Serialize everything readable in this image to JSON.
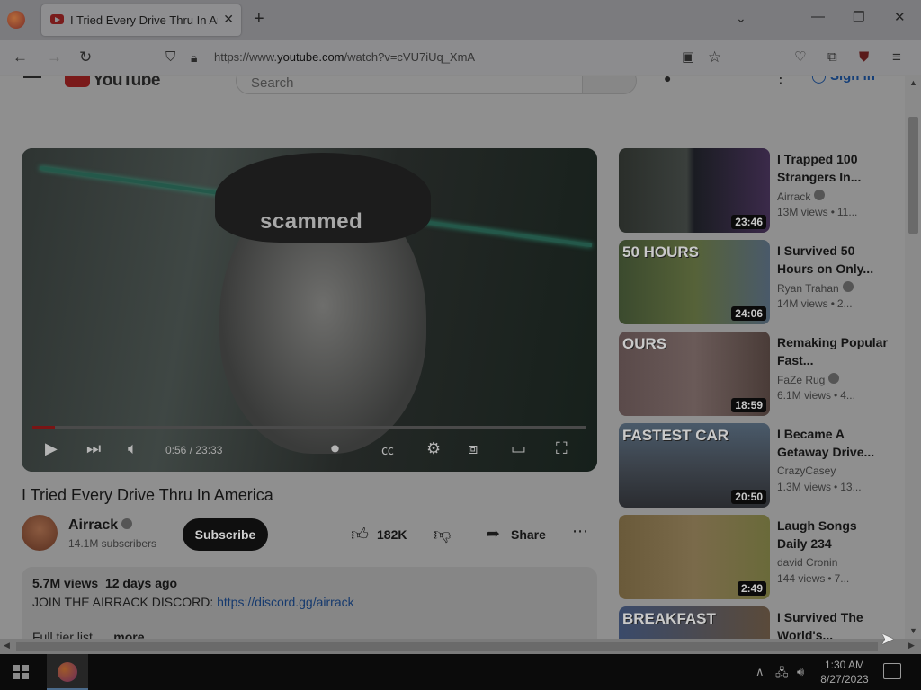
{
  "browser": {
    "tab_title": "I Tried Every Drive Thru In Ame",
    "tab_close": "✕",
    "new_tab": "+",
    "tab_list": "⌄",
    "minimize": "—",
    "maximize": "❐",
    "close": "✕",
    "url_prefix": "https://www.",
    "url_domain": "youtube.com",
    "url_suffix": "/watch?v=cVU7iUq_XmA"
  },
  "youtube": {
    "logo_text": "YouTube",
    "search_placeholder": "Search",
    "sign_in": "Sign in"
  },
  "player": {
    "overlay_text": "scammed",
    "time_current": "0:56",
    "time_sep": " / ",
    "time_total": "23:33",
    "progress_fraction": 0.04
  },
  "video": {
    "title": "I Tried Every Drive Thru In America",
    "channel": "Airrack",
    "subscribers": "14.1M subscribers",
    "subscribe_label": "Subscribe",
    "likes": "182K",
    "share_label": "Share",
    "views": "5.7M views",
    "age": "12 days ago",
    "desc_line1_prefix": "JOIN THE AIRRACK DISCORD: ",
    "desc_link": "https://discord.gg/airrack",
    "desc_line2": "Full tier list",
    "more_label": "...more"
  },
  "recommendations": [
    {
      "title": "I Trapped 100 Strangers In...",
      "channel": "Airrack",
      "views": "13M views",
      "age": "11...",
      "duration": "23:46",
      "thumb_text": "",
      "verified": true
    },
    {
      "title": "I Survived 50 Hours on Only...",
      "channel": "Ryan Trahan",
      "views": "14M views",
      "age": "2...",
      "duration": "24:06",
      "thumb_text": "50 HOURS",
      "verified": true
    },
    {
      "title": "Remaking Popular Fast...",
      "channel": "FaZe Rug",
      "views": "6.1M views",
      "age": "4...",
      "duration": "18:59",
      "thumb_text": "OURS",
      "verified": true
    },
    {
      "title": "I Became A Getaway Drive...",
      "channel": "CrazyCasey",
      "views": "1.3M views",
      "age": "13...",
      "duration": "20:50",
      "thumb_text": "FASTEST CAR",
      "verified": false
    },
    {
      "title": "Laugh Songs Daily 234",
      "channel": "david Cronin",
      "views": "144 views",
      "age": "7...",
      "duration": "2:49",
      "thumb_text": "",
      "verified": false
    },
    {
      "title": "I Survived The World's...",
      "channel": "",
      "views": "",
      "age": "",
      "duration": "",
      "thumb_text": "BREAKFAST",
      "verified": false
    }
  ],
  "taskbar": {
    "time": "1:30 AM",
    "date": "8/27/2023"
  },
  "colors": {
    "dim_overlay": "#8f8f8f",
    "subscribe_bg": "#0f0f0f",
    "link": "#163a6e"
  }
}
